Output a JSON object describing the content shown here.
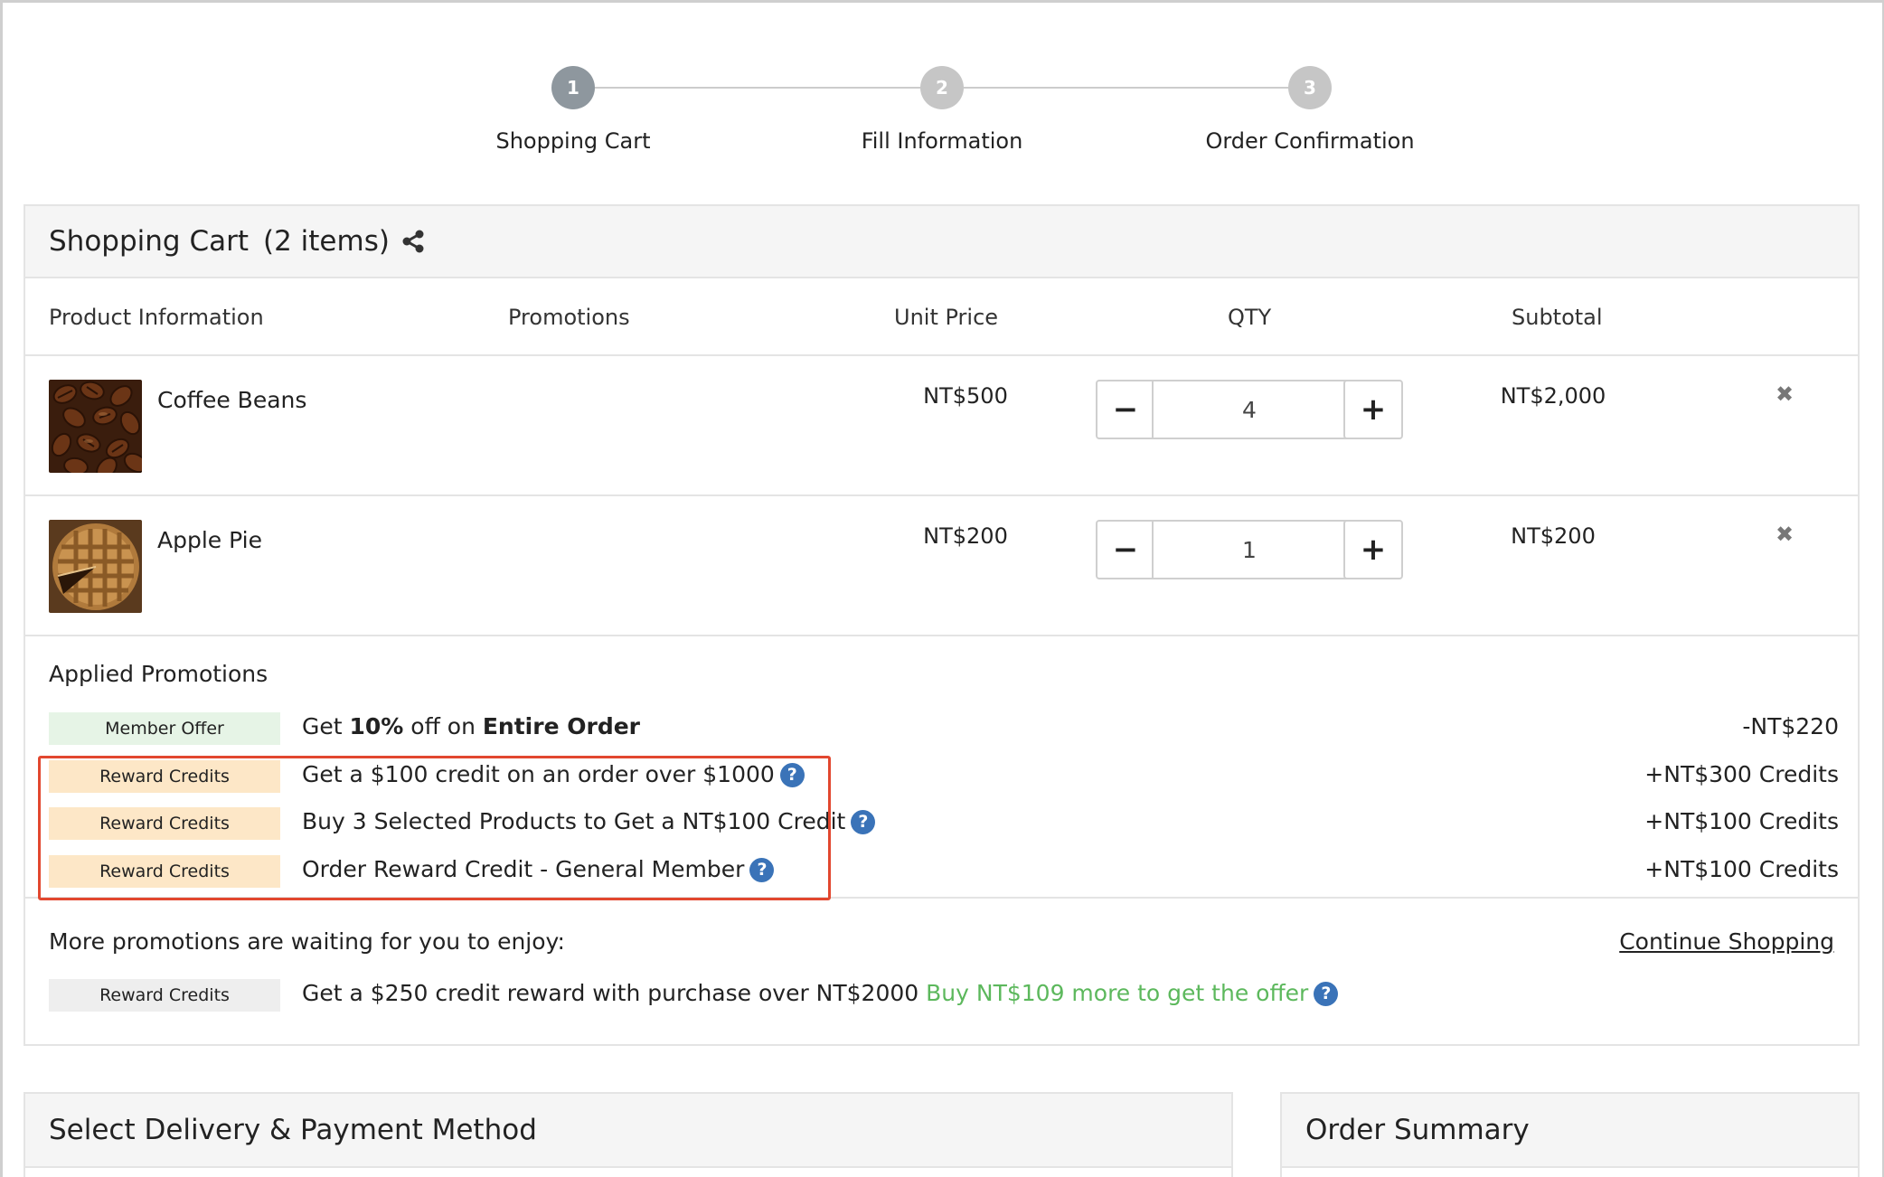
{
  "stepper": {
    "steps": [
      {
        "number": "1",
        "label": "Shopping Cart"
      },
      {
        "number": "2",
        "label": "Fill Information"
      },
      {
        "number": "3",
        "label": "Order Confirmation"
      }
    ]
  },
  "cart": {
    "title": "Shopping Cart",
    "count": "(2 items)",
    "columns": {
      "product": "Product Information",
      "promotions": "Promotions",
      "unit_price": "Unit Price",
      "qty": "QTY",
      "subtotal": "Subtotal"
    },
    "items": [
      {
        "name": "Coffee Beans",
        "unit_price": "NT$500",
        "qty": "4",
        "subtotal": "NT$2,000"
      },
      {
        "name": "Apple Pie",
        "unit_price": "NT$200",
        "qty": "1",
        "subtotal": "NT$200"
      }
    ],
    "qty_minus": "−",
    "qty_plus": "+",
    "remove_glyph": "✖"
  },
  "applied_promotions": {
    "heading": "Applied Promotions",
    "rows": [
      {
        "badge": "Member Offer",
        "pre": "Get ",
        "bold1": "10%",
        "mid": " off on ",
        "bold2": "Entire Order",
        "amount": "-NT$220"
      },
      {
        "badge": "Reward Credits",
        "text": "Get a $100 credit on an order over $1000",
        "amount": "+NT$300 Credits"
      },
      {
        "badge": "Reward Credits",
        "text": "Buy 3 Selected Products to Get a NT$100 Credit",
        "amount": "+NT$100 Credits"
      },
      {
        "badge": "Reward Credits",
        "text": "Order Reward Credit - General Member",
        "amount": "+NT$100 Credits"
      }
    ],
    "help_glyph": "?"
  },
  "more_promotions": {
    "text": "More promotions are waiting for you to enjoy:",
    "continue_label": "Continue Shopping",
    "row": {
      "badge": "Reward Credits",
      "text": "Get a $250 credit reward with purchase over NT$2000",
      "highlight": "Buy NT$109 more to get the offer"
    }
  },
  "bottom": {
    "delivery_title": "Select Delivery & Payment Method",
    "summary_title": "Order Summary"
  },
  "colors": {
    "accent_red": "#e2472f",
    "help_blue": "#3a73b8",
    "offer_green": "#5cb85c",
    "member_badge": "#e6f4e6",
    "reward_badge": "#fde7c7",
    "step_active": "#8e979e",
    "step_inactive": "#c6c6c6"
  }
}
